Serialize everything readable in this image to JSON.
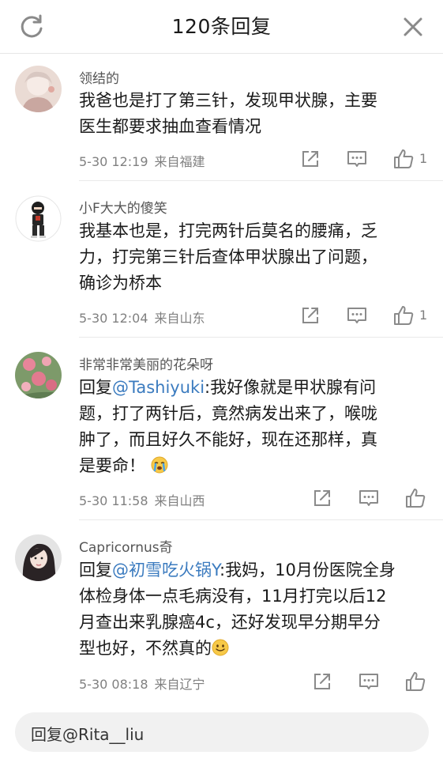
{
  "header": {
    "title": "120条回复"
  },
  "comments": [
    {
      "username": "领结的",
      "content": [
        "我爸也是打了第三针，发现甲状腺，主要",
        "医生都要求抽血查看情况"
      ],
      "time": "5-30 12:19",
      "from": "来自福建",
      "likes": "1"
    },
    {
      "username": "小F大大的傻笑",
      "content": [
        "我基本也是，打完两针后莫名的腰痛，乏",
        "力，打完第三针后查体甲状腺出了问题，",
        "确诊为桥本"
      ],
      "time": "5-30 12:04",
      "from": "来自山东",
      "likes": "1"
    },
    {
      "username": "非常非常美丽的花朵呀",
      "reply_prefix": "回复",
      "mention": "@Tashiyuki",
      "content_first": ":我好像就是甲状腺有问",
      "content": [
        "题，打了两针后，竟然病发出来了，喉咙",
        "肿了，而且好久不能好，现在还那样，真",
        "是要命！"
      ],
      "emoji": "crying-face",
      "time": "5-30 11:58",
      "from": "来自山西",
      "likes": ""
    },
    {
      "username": "Capricornus奇",
      "reply_prefix": "回复",
      "mention": "@初雪吃火锅Y",
      "content_first": ":我妈，10月份医院全身",
      "content": [
        "体检身体一点毛病没有，11月打完以后12",
        "月查出来乳腺癌4c，还好发现早分期早分",
        "型也好，不然真的"
      ],
      "emoji": "smiling-face",
      "time": "5-30 08:18",
      "from": "来自辽宁",
      "likes": ""
    }
  ],
  "reply": {
    "placeholder": "回复@Rita__liu"
  },
  "colors": {
    "mention": "#3b7bbf",
    "meta": "#808080",
    "icon": "#8a8a8a"
  },
  "icons": [
    "refresh-icon",
    "close-icon",
    "share-icon",
    "comment-icon",
    "like-icon"
  ]
}
